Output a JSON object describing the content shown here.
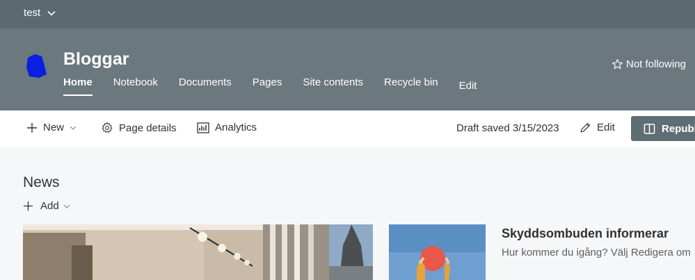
{
  "hub": {
    "name": "test"
  },
  "site": {
    "title": "Bloggar",
    "nav": [
      {
        "label": "Home",
        "active": true
      },
      {
        "label": "Notebook"
      },
      {
        "label": "Documents"
      },
      {
        "label": "Pages"
      },
      {
        "label": "Site contents"
      },
      {
        "label": "Recycle bin"
      },
      {
        "label": "Edit"
      }
    ],
    "follow_label": "Not following"
  },
  "commandbar": {
    "new_label": "New",
    "page_details_label": "Page details",
    "analytics_label": "Analytics",
    "draft_status": "Draft saved 3/15/2023",
    "edit_label": "Edit",
    "republish_label": "Republish"
  },
  "news": {
    "title": "News",
    "add_label": "Add",
    "articles": [
      {
        "title": "Skyddsombuden informerar",
        "description": "Hur kommer du igång? Välj Redigera om"
      }
    ]
  },
  "colors": {
    "hubbar": "#5b6a70",
    "header": "#6b787d",
    "logo": "#0a1fe0",
    "republish": "#5f6e74"
  },
  "icons": {
    "hub_chevron": "chevron-down-icon",
    "follow": "star-outline-icon",
    "new": "plus-icon",
    "page_details": "gear-icon",
    "analytics": "chart-icon",
    "edit": "pencil-icon",
    "republish": "book-open-icon"
  }
}
